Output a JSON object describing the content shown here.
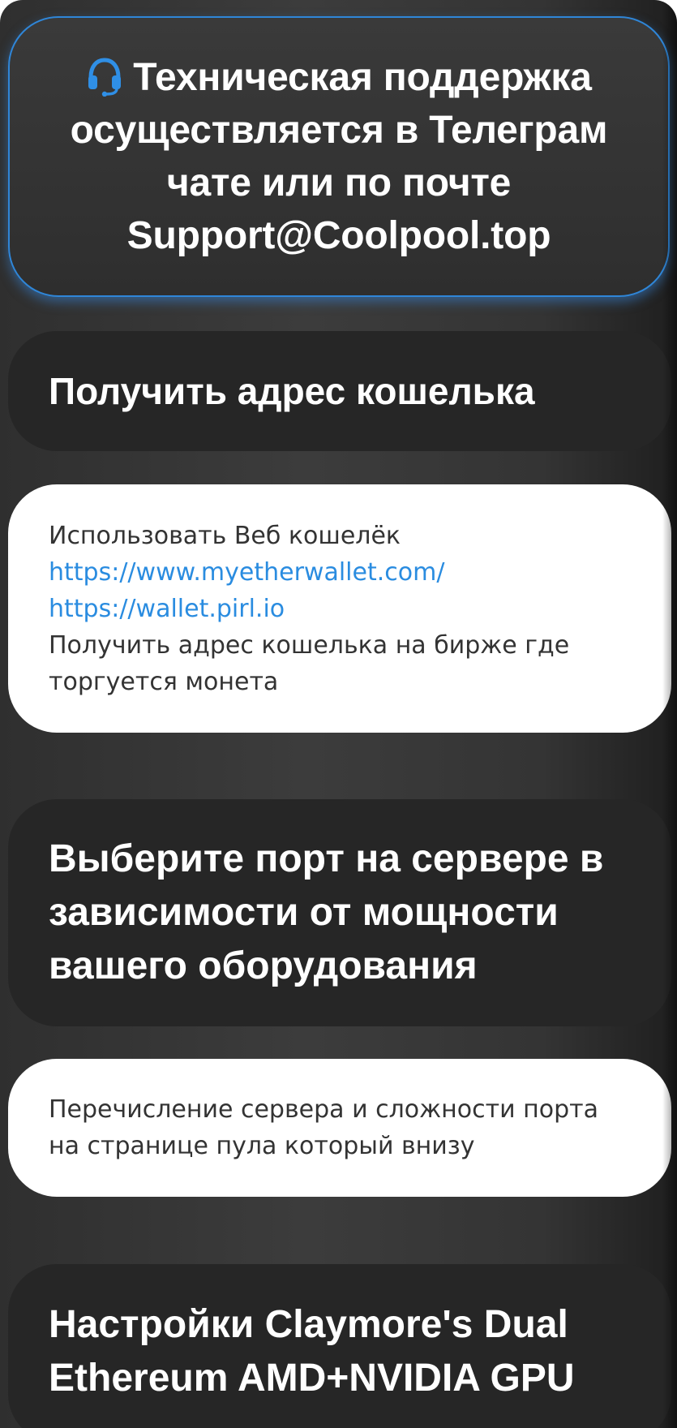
{
  "support": {
    "text": "Техническая поддержка осуществляется в Телеграм чате или по почте Support@Coolpool.top",
    "icon": "headset-icon",
    "accent_color": "#2f86d8"
  },
  "wallet": {
    "heading": "Получить адрес кошелька",
    "intro": "Использовать Веб кошелёк",
    "links": [
      "https://www.myetherwallet.com/",
      "https://wallet.pirl.io"
    ],
    "outro": "Получить адрес кошелька на бирже где торгуется монета"
  },
  "port": {
    "heading": "Выберите порт на сервере в зависимости от мощности вашего оборудования",
    "info": "Перечисление сервера и сложности порта на странице пула который внизу"
  },
  "claymore": {
    "heading": "Настройки Claymore's Dual Ethereum AMD+NVIDIA GPU"
  }
}
